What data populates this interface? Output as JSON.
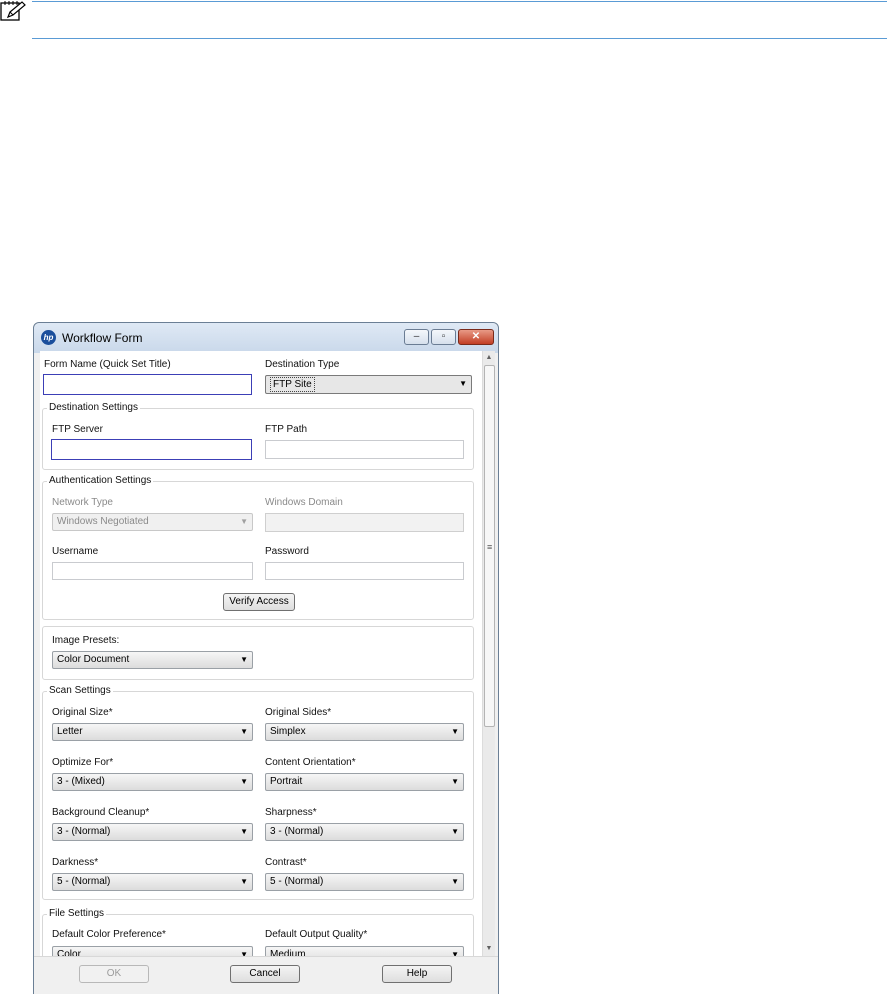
{
  "window": {
    "title": "Workflow Form",
    "logo_text": "hp"
  },
  "window_controls": {
    "minimize": "–",
    "maximize": "▫",
    "close": "✕"
  },
  "header_fields": {
    "form_name_label": "Form Name (Quick Set Title)",
    "form_name_value": "",
    "destination_type_label": "Destination Type",
    "destination_type_value": "FTP Site"
  },
  "destination_settings": {
    "title": "Destination Settings",
    "ftp_server_label": "FTP Server",
    "ftp_server_value": "",
    "ftp_path_label": "FTP Path",
    "ftp_path_value": ""
  },
  "authentication_settings": {
    "title": "Authentication Settings",
    "network_type_label": "Network Type",
    "network_type_value": "Windows Negotiated",
    "windows_domain_label": "Windows Domain",
    "username_label": "Username",
    "password_label": "Password",
    "verify_label": "Verify Access"
  },
  "image_presets": {
    "label": "Image Presets:",
    "value": "Color Document"
  },
  "scan_settings": {
    "title": "Scan Settings",
    "original_size_label": "Original Size*",
    "original_size_value": "Letter",
    "original_sides_label": "Original Sides*",
    "original_sides_value": "Simplex",
    "optimize_for_label": "Optimize For*",
    "optimize_for_value": "3 - (Mixed)",
    "content_orientation_label": "Content Orientation*",
    "content_orientation_value": "Portrait",
    "background_cleanup_label": "Background Cleanup*",
    "background_cleanup_value": "3 - (Normal)",
    "sharpness_label": "Sharpness*",
    "sharpness_value": "3 - (Normal)",
    "darkness_label": "Darkness*",
    "darkness_value": "5 - (Normal)",
    "contrast_label": "Contrast*",
    "contrast_value": "5 - (Normal)"
  },
  "file_settings": {
    "title": "File Settings",
    "color_pref_label": "Default Color Preference*",
    "color_pref_value": "Color",
    "output_quality_label": "Default Output Quality*",
    "output_quality_value": "Medium"
  },
  "footer": {
    "ok_label": "OK",
    "cancel_label": "Cancel",
    "help_label": "Help"
  },
  "icons": {
    "dropdown_arrow": "▼",
    "scroll_up": "▲",
    "scroll_down": "▼",
    "scroll_grip": "≡"
  },
  "colors": {
    "focus_border": "#3c3fb6",
    "title_bar": "#c9d8ea",
    "close_button": "#c23e24",
    "note_rule": "#5a9bd5"
  }
}
